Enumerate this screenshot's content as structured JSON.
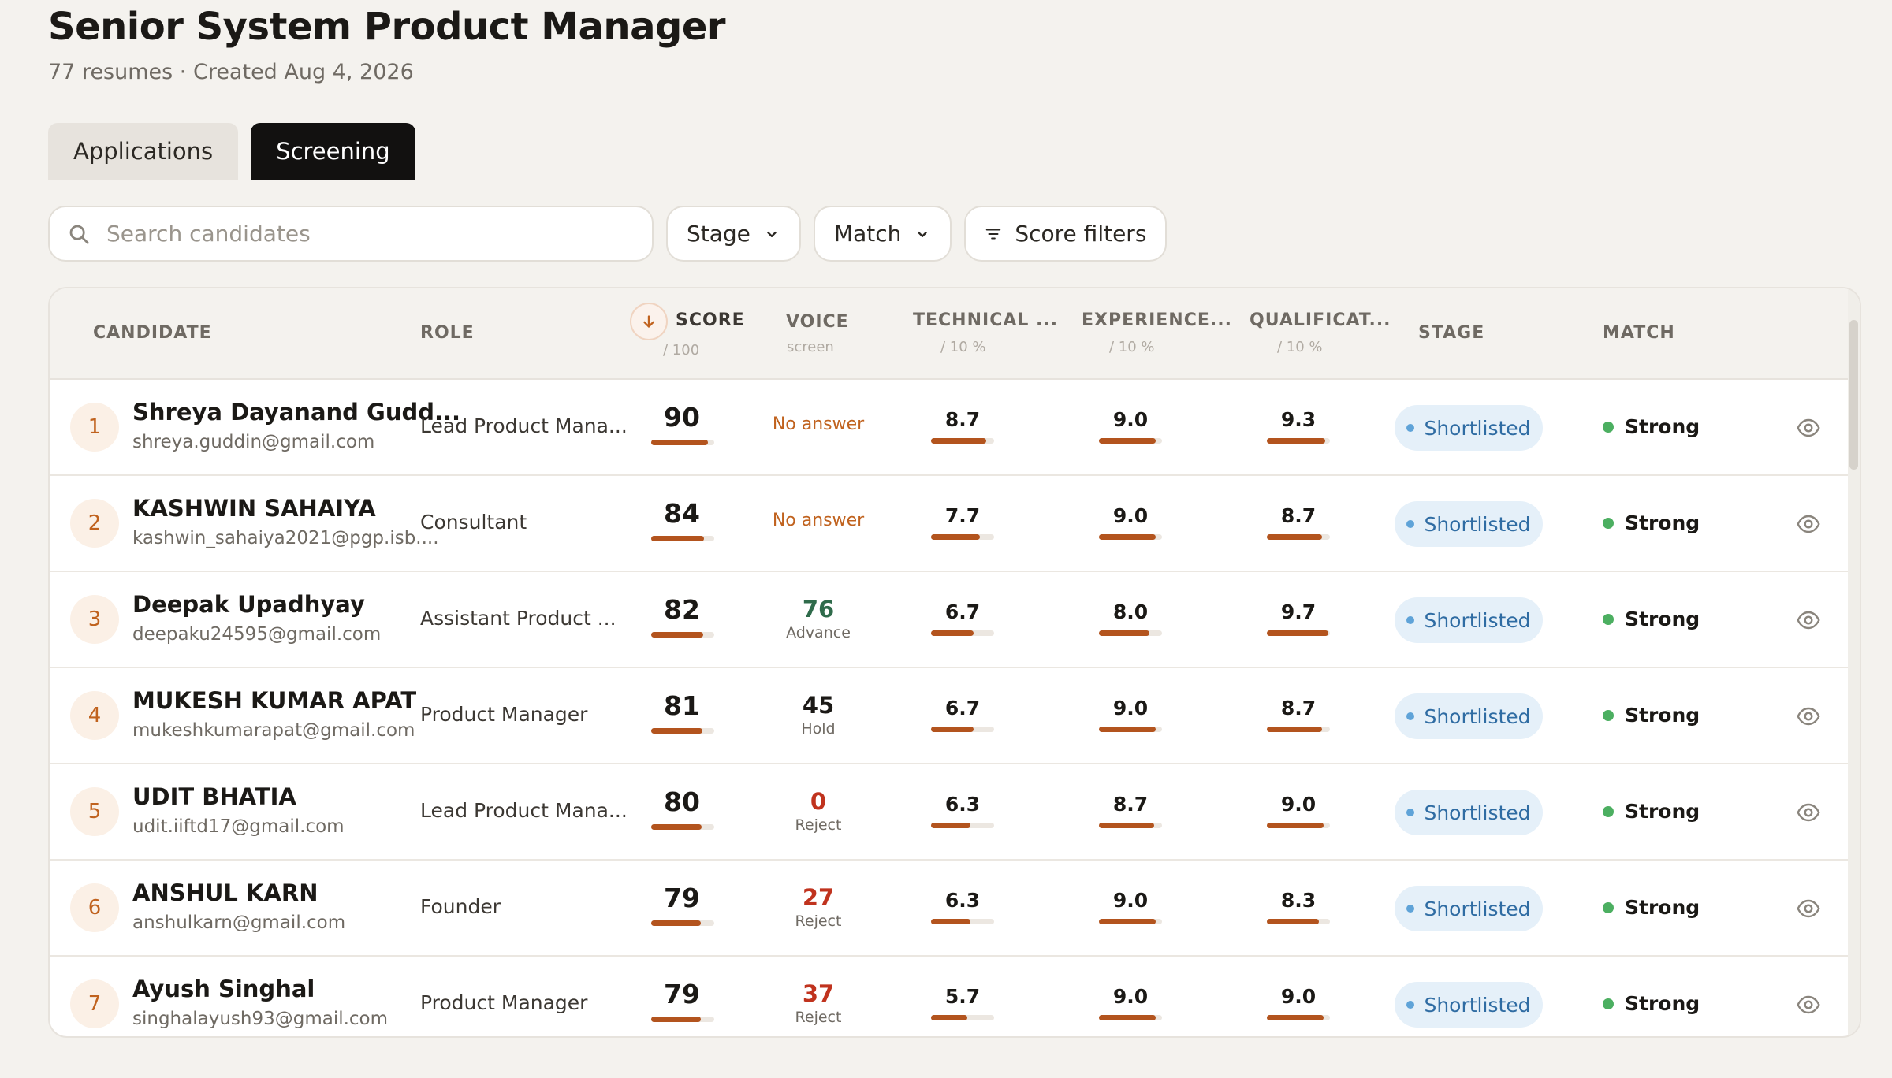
{
  "header": {
    "title": "Senior System Product Manager",
    "subtitle": "77 resumes · Created Aug 4, 2026"
  },
  "tabs": [
    {
      "label": "Applications",
      "active": false
    },
    {
      "label": "Screening",
      "active": true
    }
  ],
  "toolbar": {
    "search_placeholder": "Search candidates",
    "stage_label": "Stage",
    "match_label": "Match",
    "score_filters_label": "Score filters"
  },
  "table": {
    "columns": {
      "candidate": "CANDIDATE",
      "role": "ROLE",
      "score": "SCORE",
      "score_sub": "/ 100",
      "voice": "VOICE",
      "voice_sub": "screen",
      "technical": "TECHNICAL ...",
      "technical_sub": "/ 10 %",
      "experience": "EXPERIENCE...",
      "experience_sub": "/ 10 %",
      "qualification": "QUALIFICAT...",
      "qualification_sub": "/ 10 %",
      "stage": "STAGE",
      "match": "MATCH"
    },
    "sort": {
      "column": "score",
      "direction": "descending"
    },
    "rows": [
      {
        "rank": "1",
        "name": "Shreya Dayanand Gudd...",
        "email": "shreya.guddin@gmail.com",
        "role": "Lead Product Mana...",
        "score": "90",
        "voice": {
          "value": "No answer",
          "label": ""
        },
        "technical": "8.7",
        "experience": "9.0",
        "qualification": "9.3",
        "stage": "Shortlisted",
        "match": "Strong"
      },
      {
        "rank": "2",
        "name": "KASHWIN SAHAIYA",
        "email": "kashwin_sahaiya2021@pgp.isb....",
        "role": "Consultant",
        "score": "84",
        "voice": {
          "value": "No answer",
          "label": ""
        },
        "technical": "7.7",
        "experience": "9.0",
        "qualification": "8.7",
        "stage": "Shortlisted",
        "match": "Strong"
      },
      {
        "rank": "3",
        "name": "Deepak Upadhyay",
        "email": "deepaku24595@gmail.com",
        "role": "Assistant Product ...",
        "score": "82",
        "voice": {
          "value": "76",
          "label": "Advance"
        },
        "technical": "6.7",
        "experience": "8.0",
        "qualification": "9.7",
        "stage": "Shortlisted",
        "match": "Strong"
      },
      {
        "rank": "4",
        "name": "MUKESH KUMAR APAT",
        "email": "mukeshkumarapat@gmail.com",
        "role": "Product Manager",
        "score": "81",
        "voice": {
          "value": "45",
          "label": "Hold"
        },
        "technical": "6.7",
        "experience": "9.0",
        "qualification": "8.7",
        "stage": "Shortlisted",
        "match": "Strong"
      },
      {
        "rank": "5",
        "name": "UDIT BHATIA",
        "email": "udit.iiftd17@gmail.com",
        "role": "Lead Product Mana...",
        "score": "80",
        "voice": {
          "value": "0",
          "label": "Reject"
        },
        "technical": "6.3",
        "experience": "8.7",
        "qualification": "9.0",
        "stage": "Shortlisted",
        "match": "Strong"
      },
      {
        "rank": "6",
        "name": "ANSHUL KARN",
        "email": "anshulkarn@gmail.com",
        "role": "Founder",
        "score": "79",
        "voice": {
          "value": "27",
          "label": "Reject"
        },
        "technical": "6.3",
        "experience": "9.0",
        "qualification": "8.3",
        "stage": "Shortlisted",
        "match": "Strong"
      },
      {
        "rank": "7",
        "name": "Ayush Singhal",
        "email": "singhalayush93@gmail.com",
        "role": "Product Manager",
        "score": "79",
        "voice": {
          "value": "37",
          "label": "Reject"
        },
        "technical": "5.7",
        "experience": "9.0",
        "qualification": "9.0",
        "stage": "Shortlisted",
        "match": "Strong"
      }
    ]
  },
  "colors": {
    "accent": "#b3541e",
    "advance": "#2f6b4b",
    "hold": "#1b1916",
    "reject": "#c0331e",
    "match_strong": "#4caf61",
    "stage_badge_bg": "#e5f0f9",
    "stage_badge_text": "#2f6ca3"
  },
  "icons": {
    "search": "search-icon",
    "chevron": "chevron-down-icon",
    "filter": "filter-icon",
    "sort": "arrow-down-icon",
    "view": "eye-icon"
  }
}
